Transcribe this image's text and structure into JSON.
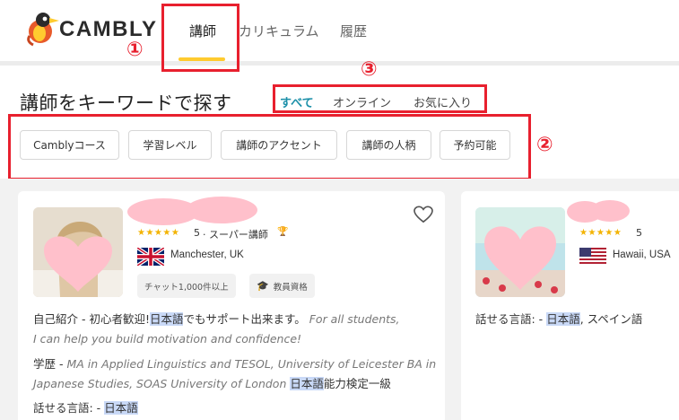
{
  "header": {
    "brand": "CAMBLY",
    "nav": [
      {
        "label": "講師",
        "active": true
      },
      {
        "label": "カリキュラム",
        "active": false
      },
      {
        "label": "履歴",
        "active": false
      }
    ]
  },
  "search": {
    "title": "講師をキーワードで探す",
    "tabs": [
      {
        "label": "すべて",
        "active": true
      },
      {
        "label": "オンライン",
        "active": false
      },
      {
        "label": "お気に入り",
        "active": false
      }
    ],
    "filters": [
      "Camblyコース",
      "学習レベル",
      "講師のアクセント",
      "講師の人柄",
      "予約可能"
    ]
  },
  "annotations": [
    "①",
    "②",
    "③"
  ],
  "tutors": [
    {
      "rating": "5",
      "rating_suffix": "· スーパー講師",
      "location": "Manchester, UK",
      "badges": [
        "チャット1,000件以上",
        "教員資格"
      ],
      "intro_prefix": "自己紹介 - 初心者歓迎!",
      "intro_hl": "日本語",
      "intro_rest": "でもサポート出来ます。",
      "intro_en_1": "For all students,",
      "intro_en_2": "I can help you build motivation and confidence!",
      "edu_label": "学歴 -",
      "edu_1": "MA in Applied Linguistics and TESOL, University of Leicester BA in",
      "edu_2a": "Japanese Studies, SOAS University of London",
      "edu_2hl": "日本語",
      "edu_2b": "能力検定一級",
      "lang_label": "話せる言語: -",
      "lang_hl": "日本語"
    },
    {
      "rating": "5",
      "location": "Hawaii, USA",
      "lang_label": "話せる言語: -",
      "lang_hl": "日本語",
      "lang_rest": ", スペイン語"
    }
  ],
  "colors": {
    "accent_yellow": "#ffcb2f",
    "tab_active": "#1a8fa8",
    "annotation_red": "#e8202e",
    "highlight": "#c9d9f7",
    "mask_pink": "#ffc0cb"
  }
}
